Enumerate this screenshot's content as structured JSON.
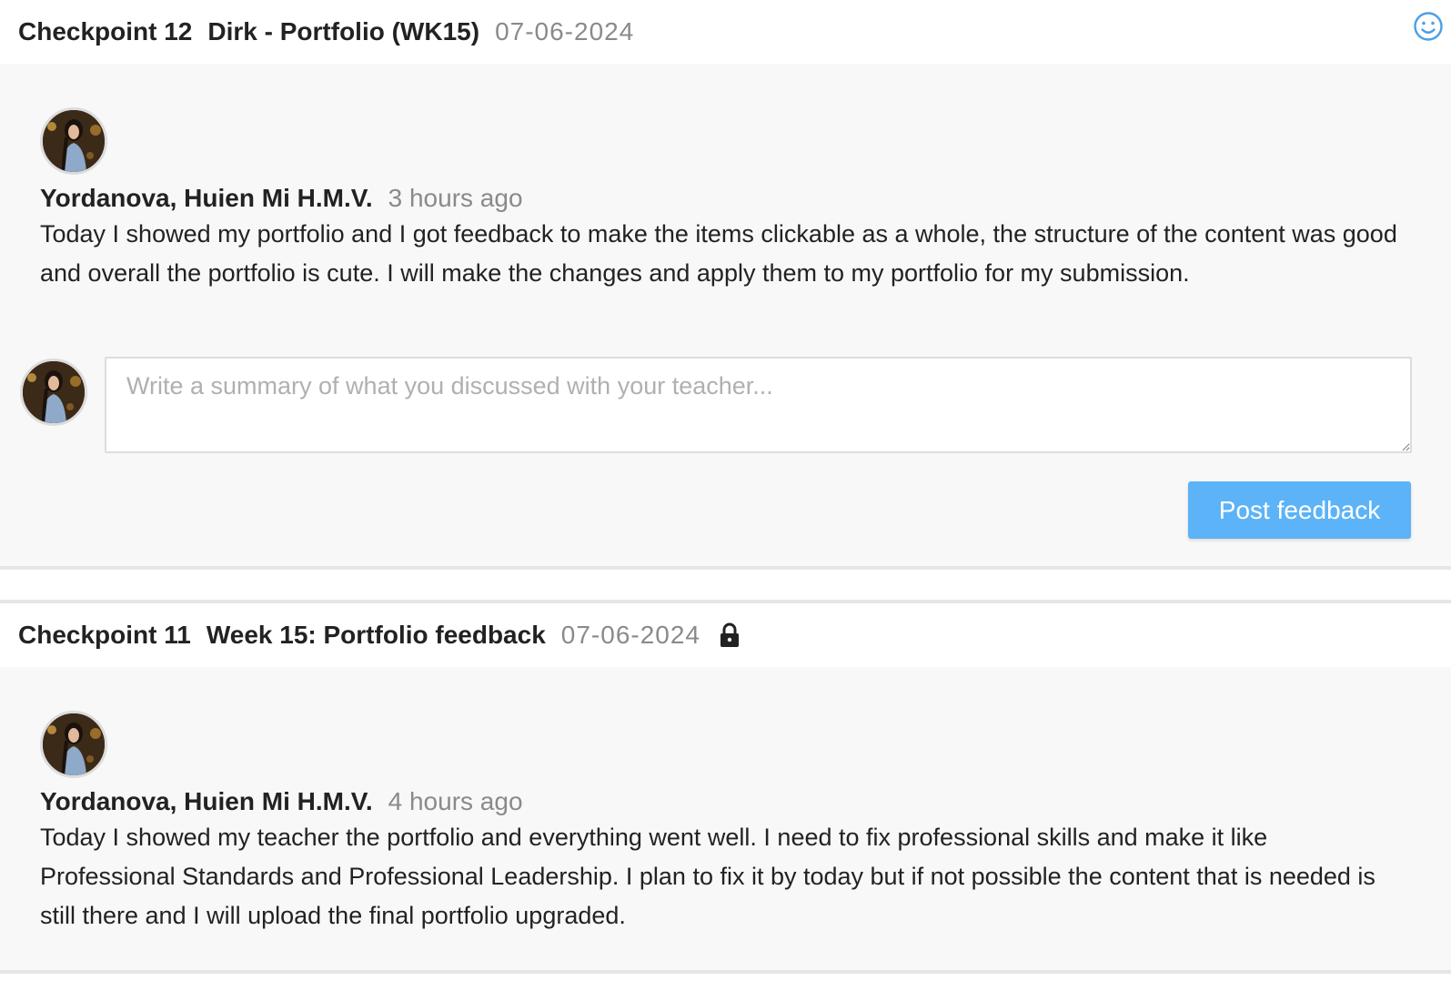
{
  "checkpoints": [
    {
      "number": "Checkpoint 12",
      "title": "Dirk - Portfolio (WK15)",
      "date": "07-06-2024",
      "entry": {
        "author": "Yordanova, Huien Mi H.M.V.",
        "time": "3 hours ago",
        "text": "Today I showed my portfolio and I got feedback to make the items clickable as a whole, the structure of the content was good and overall the portfolio is cute. I will make the changes and apply them to my portfolio for my submission."
      },
      "compose": {
        "placeholder": "Write a summary of what you discussed with your teacher...",
        "value": "",
        "button_label": "Post feedback"
      }
    },
    {
      "number": "Checkpoint 11",
      "title": "Week 15: Portfolio feedback",
      "date": "07-06-2024",
      "locked": true,
      "entry": {
        "author": "Yordanova, Huien Mi H.M.V.",
        "time": "4 hours ago",
        "text": "Today I showed my teacher the portfolio and everything went well. I need to fix professional skills and make it like Professional Standards and Professional Leadership. I plan to fix it by today but if not possible the content that is needed is still there and I will upload the final portfolio upgraded."
      }
    }
  ],
  "icons": {
    "header_right": "smiley-icon",
    "locked": "lock-icon"
  },
  "colors": {
    "accent": "#5cb3f7",
    "smiley": "#4a9fe8",
    "muted_text": "#8a8a8a",
    "panel_bg": "#f8f8f8"
  }
}
